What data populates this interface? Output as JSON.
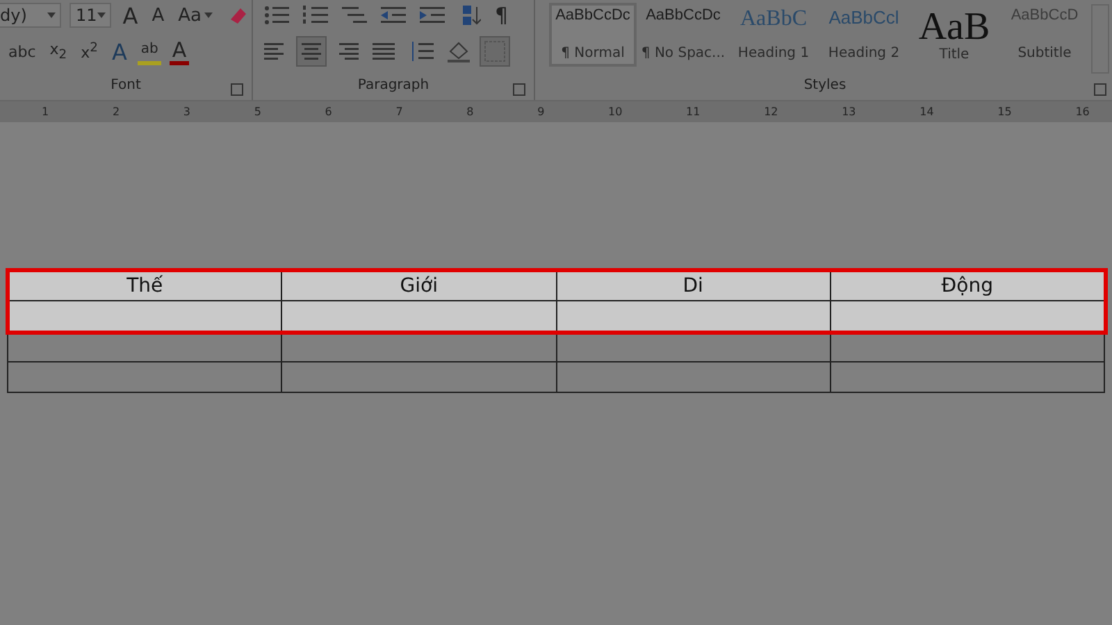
{
  "ribbon": {
    "font": {
      "font_name": "dy)",
      "font_size": "11",
      "row1": [
        {
          "kind": "grow",
          "label": "A"
        },
        {
          "kind": "shrink",
          "label": "A"
        },
        {
          "kind": "case",
          "label": "Aa"
        },
        {
          "kind": "clear"
        }
      ],
      "row2": [
        {
          "kind": "text",
          "label": "abc"
        },
        {
          "kind": "text",
          "label": "x$_{2}$"
        },
        {
          "kind": "text",
          "label": "x$^{2}$"
        },
        {
          "kind": "effect",
          "label": "A"
        },
        {
          "kind": "highlight",
          "label": "ab"
        },
        {
          "kind": "color",
          "label": "A"
        }
      ],
      "label": "Font"
    },
    "paragraph": {
      "row1": [
        {
          "kind": "bullets"
        },
        {
          "kind": "numbers"
        },
        {
          "kind": "multilevel"
        },
        {
          "kind": "outdent"
        },
        {
          "kind": "indent"
        },
        {
          "kind": "sort"
        },
        {
          "kind": "pilcrow",
          "label": "¶"
        }
      ],
      "align": [
        {
          "kind": "left",
          "selected": false
        },
        {
          "kind": "center",
          "selected": true
        },
        {
          "kind": "right",
          "selected": false
        },
        {
          "kind": "justify",
          "selected": false
        }
      ],
      "label": "Paragraph"
    },
    "styles": {
      "items": [
        {
          "preview": "AaBbCcDc",
          "name": "¶ Normal",
          "kind": "normal",
          "selected": true
        },
        {
          "preview": "AaBbCcDc",
          "name": "¶ No Spac...",
          "kind": "normal",
          "selected": false
        },
        {
          "preview": "AaBbC",
          "name": "Heading 1",
          "kind": "heading1",
          "selected": false
        },
        {
          "preview": "AaBbCcl",
          "name": "Heading 2",
          "kind": "heading2",
          "selected": false
        },
        {
          "preview": "AaB",
          "name": "Title",
          "kind": "title",
          "selected": false
        },
        {
          "preview": "AaBbCcD",
          "name": "Subtitle",
          "kind": "subtitle",
          "selected": false
        }
      ],
      "label": "Styles"
    }
  },
  "ruler": [
    "1",
    "2",
    "3",
    "5",
    "6",
    "7",
    "8",
    "9",
    "10",
    "11",
    "12",
    "13",
    "14",
    "15",
    "16"
  ],
  "table": {
    "rows": [
      {
        "selected": true,
        "cells": [
          "Thế",
          "Giới",
          "Di",
          "Động"
        ]
      },
      {
        "selected": true,
        "cells": [
          "",
          "",
          "",
          ""
        ]
      },
      {
        "selected": false,
        "cells": [
          "",
          "",
          "",
          ""
        ]
      },
      {
        "selected": false,
        "cells": [
          "",
          "",
          "",
          ""
        ]
      }
    ]
  }
}
